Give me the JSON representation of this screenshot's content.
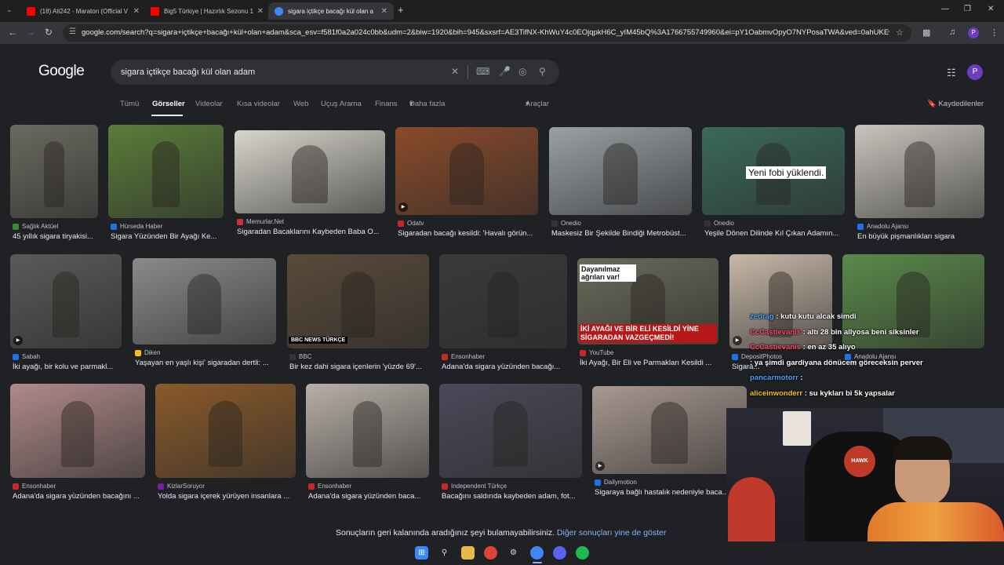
{
  "browser": {
    "tabs": [
      {
        "title": "(18) Ati242 - Maraton (Official V",
        "left": 0
      },
      {
        "title": "Big5 Türkiye | Hazırlık Sezonu 1",
        "left": 0
      },
      {
        "title": "sigara içtikçe bacağı kül olan a",
        "left": 0
      }
    ],
    "new_tab": "+",
    "url": "google.com/search?q=sigara+içtikçe+bacağı+kül+olan+adam&sca_esv=f581f0a2a024c0bb&udm=2&biw=1920&bih=945&sxsrf=AE3TifNX-KhWuY4c0EOjqpkH6C_yIM45bQ%3A1766755749960&ei=pY1OabmvOpyO7NYPosaTWA&ved=0ahUKEwjI5k",
    "profile_letter": "P"
  },
  "google": {
    "logo": "Google",
    "query": "sigara içtikçe bacağı kül olan adam",
    "avatar_letter": "P",
    "filters": [
      "Tümü",
      "Görseller",
      "Videolar",
      "Kısa videolar",
      "Web",
      "Uçuş Arama",
      "Finans",
      "Daha fazla"
    ],
    "tools": "Araçlar",
    "saved": "Kaydedilenler"
  },
  "results": [
    {
      "source": "Sağlık Aktüel",
      "caption": "45 yıllık sigara tiryakisi...",
      "color": "#3a8a3a",
      "thumb": "#6b6a60"
    },
    {
      "source": "Hürseda Haber",
      "caption": "Sigara Yüzünden Bir Ayağı Ke...",
      "color": "#1a73e8",
      "thumb": "#5b7d3a"
    },
    {
      "source": "Memurlar.Net",
      "caption": "Sigaradan Bacaklarını Kaybeden Baba O...",
      "color": "#cc3333",
      "thumb": "#d8d5cc"
    },
    {
      "source": "Odatv",
      "caption": "Sigaradan bacağı kesildi: 'Havalı görün...",
      "color": "#c62828",
      "thumb": "#8a4a2a",
      "video": true
    },
    {
      "source": "Onedio",
      "caption": "Maskesiz Bir Şekilde Bindiği Metrobüst...",
      "color": "#333333",
      "thumb": "#9aa0a6"
    },
    {
      "source": "Onedio",
      "caption": "Yeşile Dönen Dilinde Kıl Çıkan Adamın...",
      "color": "#333333",
      "thumb": "#3a6a5a",
      "overlay": "Yeni fobi yüklendi."
    },
    {
      "source": "Anadolu Ajansı",
      "caption": "En büyük pişmanlıkları sigara",
      "color": "#1a73e8",
      "thumb": "#c9c5be"
    },
    {
      "source": "Sabah",
      "caption": "İki ayağı, bir kolu ve parmakl...",
      "color": "#1a73e8",
      "thumb": "#5a5a58",
      "video": true
    },
    {
      "source": "Diken",
      "caption": "Yaşayan en yaşlı kişi' sigaradan dertli: ...",
      "color": "#f4c20d",
      "thumb": "#8a8a8a"
    },
    {
      "source": "BBC",
      "caption": "Bir kez dahi sigara içenlerin 'yüzde 69'...",
      "color": "#333333",
      "thumb": "#5a4a3a",
      "badge": "BBC NEWS TÜRKÇE"
    },
    {
      "source": "Ensonhaber",
      "caption": "Adana'da sigara yüzünden bacağı...",
      "color": "#c62828",
      "thumb": "#3a3a3a"
    },
    {
      "source": "YouTube",
      "caption": "İki Ayağı, Bir Eli ve Parmakları Kesildi ...",
      "color": "#c62828",
      "thumb": "#6a6a5a",
      "video": true,
      "banner_top": "Dayanılmaz ağrıları var!",
      "banner_bottom": "İKİ AYAĞI VE BİR ELİ KESİLDİ YİNE SİGARADAN VAZGEÇMEDİ!"
    },
    {
      "source": "DepositPhotos",
      "caption": "Sigara...",
      "color": "#1a73e8",
      "thumb": "#c8b8a8",
      "video": true
    },
    {
      "source": "Anadolu Ajansı",
      "caption": "",
      "color": "#1a73e8",
      "thumb": "#5a8a4a"
    },
    {
      "source": "Ensonhaber",
      "caption": "Adana'da sigara yüzünden bacağını ...",
      "color": "#c62828",
      "thumb": "#b08a8a"
    },
    {
      "source": "KizlarSoruyor",
      "caption": "Yolda sigara içerek yürüyen insanlara ...",
      "color": "#7b1fa2",
      "thumb": "#8a5a2a"
    },
    {
      "source": "Ensonhaber",
      "caption": "Adana'da sigara yüzünden baca...",
      "color": "#c62828",
      "thumb": "#b8b0a8"
    },
    {
      "source": "Independent Türkçe",
      "caption": "Bacağını saldırıda kaybeden adam, fot...",
      "color": "#c62828",
      "thumb": "#4a4a5a"
    },
    {
      "source": "Dailymotion",
      "caption": "Sigaraya bağlı hastalık nedeniyle baca...",
      "color": "#1a73e8",
      "thumb": "#a89890",
      "video": true
    }
  ],
  "footer": {
    "message": "Sonuçların geri kalanında aradığınız şeyi bulamayabilirsiniz.",
    "link": "Diğer sonuçları yine de göster"
  },
  "chat": [
    {
      "user": "zedrag",
      "text": ": kutu kutu alcak simdi",
      "color": "#4aa0ff"
    },
    {
      "user": "CcCastievanis",
      "text": ": altı 28 bin allyosa beni siksinler",
      "color": "#ff4a6a"
    },
    {
      "user": "CcCastievanis",
      "text": ": en az 35 alıyo",
      "color": "#ff4a6a"
    },
    {
      "user": "",
      "text": ": ya şimdi gardiyana dönücem göreceksin perver",
      "color": "#ff4a6a"
    },
    {
      "user": "pancarmotorr",
      "text": ":",
      "color": "#4aa0ff"
    },
    {
      "user": "aliceinwonderr",
      "text": ": su kykları bi 5k yapsalar",
      "color": "#f4c20d"
    }
  ]
}
